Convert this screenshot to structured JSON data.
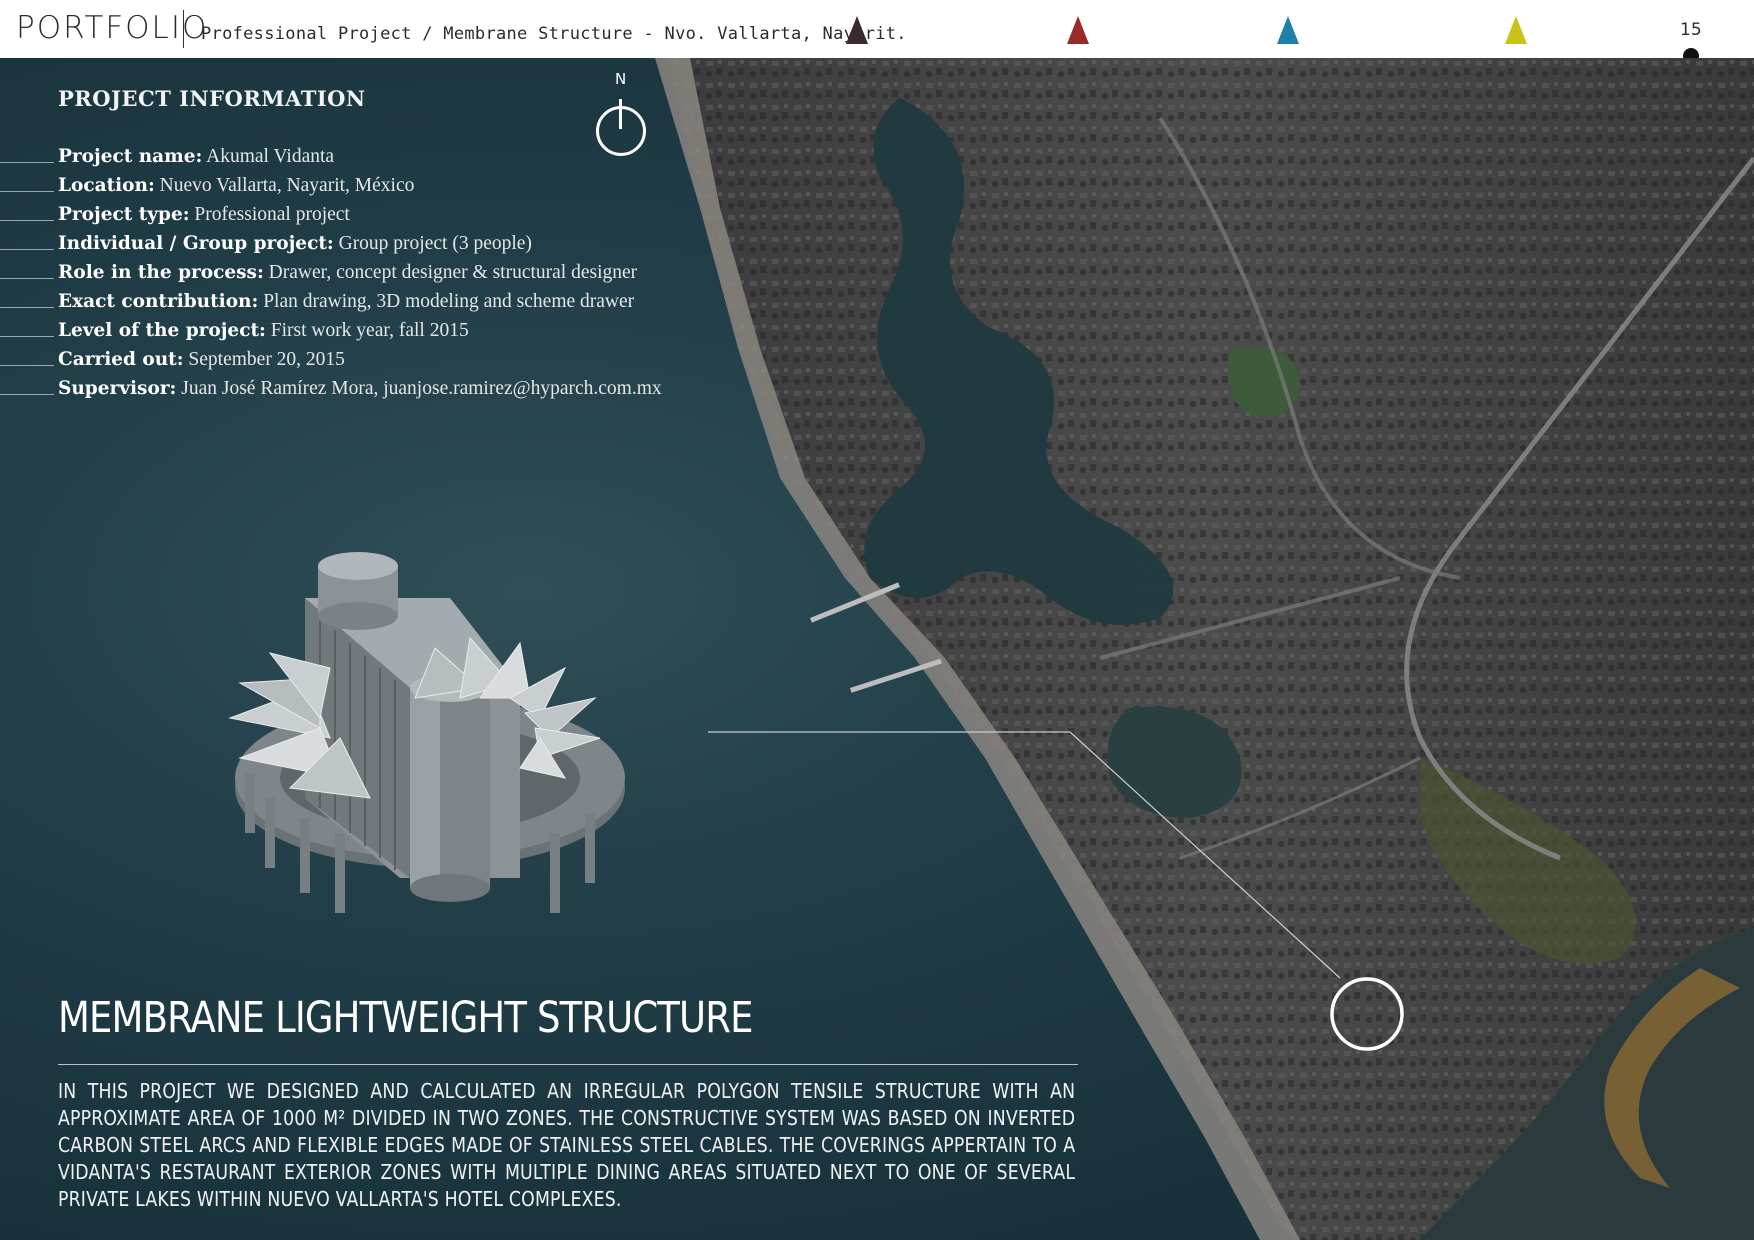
{
  "header": {
    "brand": "PORTFOLIO",
    "breadcrumb": "Professional Project / Membrane Structure - Nvo. Vallarta, Nayarit.",
    "page_number": "15",
    "markers": [
      {
        "icon": "triangle-marker-icon",
        "color": "#3a2a30"
      },
      {
        "icon": "triangle-marker-icon",
        "color": "#9b2a2a"
      },
      {
        "icon": "triangle-marker-icon",
        "color": "#1f7fa8"
      },
      {
        "icon": "triangle-marker-icon",
        "color": "#c9c21a"
      }
    ]
  },
  "info": {
    "title": "PROJECT INFORMATION",
    "rows": [
      {
        "label": "Project name:",
        "value": "Akumal Vidanta"
      },
      {
        "label": "Location:",
        "value": "Nuevo Vallarta, Nayarit, México"
      },
      {
        "label": "Project type:",
        "value": "Professional project"
      },
      {
        "label": "Individual / Group project:",
        "value": "Group project (3 people)"
      },
      {
        "label": "Role in the process:",
        "value": "Drawer, concept designer & structural designer"
      },
      {
        "label": "Exact contribution:",
        "value": "Plan drawing, 3D modeling and scheme drawer"
      },
      {
        "label": "Level of the project:",
        "value": "First work year, fall 2015"
      },
      {
        "label": "Carried out:",
        "value": "September 20, 2015"
      },
      {
        "label": "Supervisor:",
        "value": "Juan José Ramírez Mora, juanjose.ramirez@hyparch.com.mx"
      }
    ]
  },
  "north": {
    "label": "N",
    "icon": "north-arrow-icon"
  },
  "section": {
    "title": "MEMBRANE LIGHTWEIGHT STRUCTURE",
    "description": "In this project we designed and calculated an irregular polygon tensile structure with an approximate area of 1000 m² divided in two zones. The constructive system was based on inverted carbon steel arcs and flexible edges made of stainless steel cables. The coverings appertain to a Vidanta's restaurant exterior zones with multiple dining areas situated next to one of several private lakes within Nuevo Vallarta's hotel complexes."
  },
  "colors": {
    "sea": "#1e3a44",
    "land": "#4a4a4a",
    "beach": "#8a8580"
  }
}
